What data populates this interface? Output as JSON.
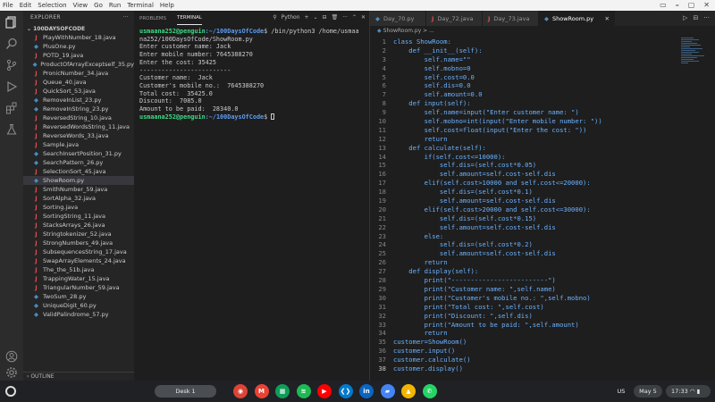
{
  "menu": [
    "File",
    "Edit",
    "Selection",
    "View",
    "Go",
    "Run",
    "Terminal",
    "Help"
  ],
  "window_controls": {
    "cast": "▭",
    "minimize": "–",
    "maximize": "▢",
    "close": "✕"
  },
  "explorer": {
    "title": "EXPLORER",
    "more": "···",
    "project": "100DAYSOFCODE",
    "files": [
      {
        "name": "PlayWithNumber_18.java",
        "type": "java"
      },
      {
        "name": "PlusOne.py",
        "type": "py"
      },
      {
        "name": "POTD_19.java",
        "type": "java"
      },
      {
        "name": "ProductOfArrayExceptself_35.py",
        "type": "py"
      },
      {
        "name": "PronicNumber_34.java",
        "type": "java"
      },
      {
        "name": "Queue_40.java",
        "type": "java"
      },
      {
        "name": "QuickSort_53.java",
        "type": "java"
      },
      {
        "name": "RemoveInList_23.py",
        "type": "py"
      },
      {
        "name": "RemoveInString_23.py",
        "type": "py"
      },
      {
        "name": "ReversedString_10.java",
        "type": "java"
      },
      {
        "name": "ReversedWordsString_11.java",
        "type": "java"
      },
      {
        "name": "ReverseWords_33.java",
        "type": "java"
      },
      {
        "name": "Sample.java",
        "type": "java"
      },
      {
        "name": "SearchInsertPosition_31.py",
        "type": "py"
      },
      {
        "name": "SearchPattern_26.py",
        "type": "py"
      },
      {
        "name": "SelectionSort_45.java",
        "type": "java"
      },
      {
        "name": "ShowRoom.py",
        "type": "py",
        "selected": true
      },
      {
        "name": "SmithNumber_59.java",
        "type": "java"
      },
      {
        "name": "SortAlpha_32.java",
        "type": "java"
      },
      {
        "name": "Sorting.java",
        "type": "java"
      },
      {
        "name": "SortingString_11.java",
        "type": "java"
      },
      {
        "name": "StacksArrays_26.java",
        "type": "java"
      },
      {
        "name": "Stringtokenizer_52.java",
        "type": "java"
      },
      {
        "name": "StrongNumbers_49.java",
        "type": "java"
      },
      {
        "name": "SubsequencesString_17.java",
        "type": "java"
      },
      {
        "name": "SwapArrayElements_24.java",
        "type": "java"
      },
      {
        "name": "The_the_51b.java",
        "type": "java"
      },
      {
        "name": "TrappingWater_15.java",
        "type": "java"
      },
      {
        "name": "TriangularNumber_59.java",
        "type": "java"
      },
      {
        "name": "TwoSum_28.py",
        "type": "py"
      },
      {
        "name": "UniqueDigit_60.py",
        "type": "py"
      },
      {
        "name": "ValidPalindrome_57.py",
        "type": "py"
      }
    ],
    "outline": "OUTLINE"
  },
  "terminal": {
    "tabs": [
      "PROBLEMS",
      "TERMINAL"
    ],
    "shell_label": "Python",
    "controls": {
      "add": "+",
      "dropdown": "⌄",
      "split": "⊟",
      "trash": "🗑",
      "more": "···",
      "chevron": "⌃",
      "close": "✕"
    },
    "prompt_user": "usmaana252@penguin",
    "prompt_path": ":~/100DaysOfCode",
    "command_1": "$ /bin/python3 /home/usmaa",
    "command_1_wrap": "na252/100DaysOfCode/ShowRoom.py",
    "output": [
      "Enter customer name: Jack",
      "Enter mobile number: 7645388270",
      "Enter the cost: 35425",
      "-------------------------",
      "Customer name:  Jack",
      "Customer's mobile no.:  7645388270",
      "Total cost:  35425.0",
      "Discount:  7085.0",
      "Amount to be paid:  28340.0"
    ],
    "prompt_end": "$ "
  },
  "editor": {
    "tabs": [
      {
        "name": "Day_70.py",
        "type": "py"
      },
      {
        "name": "Day_72.java",
        "type": "java"
      },
      {
        "name": "Day_73.java",
        "type": "java"
      },
      {
        "name": "ShowRoom.py",
        "type": "py",
        "active": true
      }
    ],
    "tab_close": "✕",
    "controls": {
      "run": "▷",
      "split": "⊟",
      "more": "···"
    },
    "breadcrumb": "ShowRoom.py > ...",
    "lines": [
      "class ShowRoom:",
      "    def __init__(self):",
      "        self.name=\"\"",
      "        self.mobno=0",
      "        self.cost=0.0",
      "        self.dis=0.0",
      "        self.amount=0.0",
      "    def input(self):",
      "        self.name=input(\"Enter customer name: \")",
      "        self.mobno=int(input(\"Enter mobile number: \"))",
      "        self.cost=float(input(\"Enter the cost: \"))",
      "        return",
      "    def calculate(self):",
      "        if(self.cost<=10000):",
      "            self.dis=(self.cost*0.05)",
      "            self.amount=self.cost-self.dis",
      "        elif(self.cost>10000 and self.cost<=20000):",
      "            self.dis=(self.cost*0.1)",
      "            self.amount=self.cost-self.dis",
      "        elif(self.cost>20000 and self.cost<=30000):",
      "            self.dis=(self.cost*0.15)",
      "            self.amount=self.cost-self.dis",
      "        else:",
      "            self.dis=(self.cost*0.2)",
      "            self.amount=self.cost-self.dis",
      "        return",
      "    def display(self):",
      "        print(\"-------------------------\")",
      "        print(\"Customer name: \",self.name)",
      "        print(\"Customer's mobile no.: \",self.mobno)",
      "        print(\"Total cost: \",self.cost)",
      "        print(\"Discount: \",self.dis)",
      "        print(\"Amount to be paid: \",self.amount)",
      "        return",
      "customer=ShowRoom()",
      "customer.input()",
      "customer.calculate()",
      "customer.display()"
    ],
    "current_line": 38
  },
  "shelf": {
    "desk": "Desk 1",
    "apps": [
      {
        "name": "chrome",
        "glyph": "◉",
        "color": "#db4437"
      },
      {
        "name": "gmail",
        "glyph": "M",
        "color": "#ea4335"
      },
      {
        "name": "sheets",
        "glyph": "▦",
        "color": "#0f9d58"
      },
      {
        "name": "spotify",
        "glyph": "≋",
        "color": "#1db954"
      },
      {
        "name": "youtube",
        "glyph": "▶",
        "color": "#ff0000"
      },
      {
        "name": "vscode",
        "glyph": "❮❯",
        "color": "#007acc"
      },
      {
        "name": "linkedin",
        "glyph": "in",
        "color": "#0a66c2"
      },
      {
        "name": "files",
        "glyph": "▰",
        "color": "#4285f4"
      },
      {
        "name": "drive",
        "glyph": "▲",
        "color": "#f4b400"
      },
      {
        "name": "whatsapp",
        "glyph": "✆",
        "color": "#25d366"
      }
    ],
    "lang": "US",
    "date": "May 5",
    "time": "17:33"
  }
}
